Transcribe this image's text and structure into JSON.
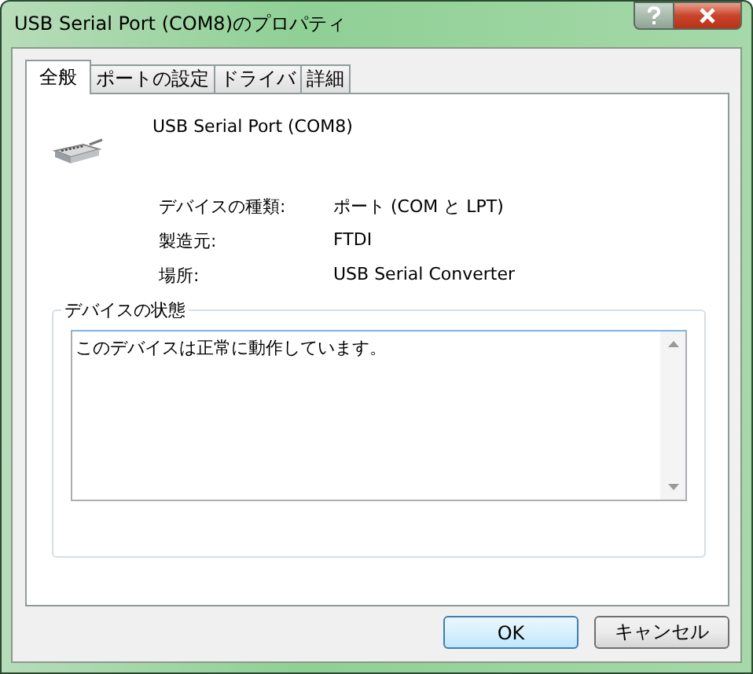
{
  "window": {
    "title": "USB Serial Port (COM8)のプロパティ"
  },
  "tabs": [
    {
      "label": "全般",
      "selected": true
    },
    {
      "label": "ポートの設定",
      "selected": false
    },
    {
      "label": "ドライバ",
      "selected": false
    },
    {
      "label": "詳細",
      "selected": false
    }
  ],
  "device": {
    "name": "USB Serial Port (COM8)"
  },
  "properties": [
    {
      "label": "デバイスの種類:",
      "value": "ポート (COM と LPT)"
    },
    {
      "label": "製造元:",
      "value": "FTDI"
    },
    {
      "label": "場所:",
      "value": "USB Serial Converter"
    }
  ],
  "status": {
    "title": "デバイスの状態",
    "text": "このデバイスは正常に動作しています。"
  },
  "buttons": [
    {
      "label": "OK",
      "default": true
    },
    {
      "label": "キャンセル",
      "default": false
    }
  ]
}
